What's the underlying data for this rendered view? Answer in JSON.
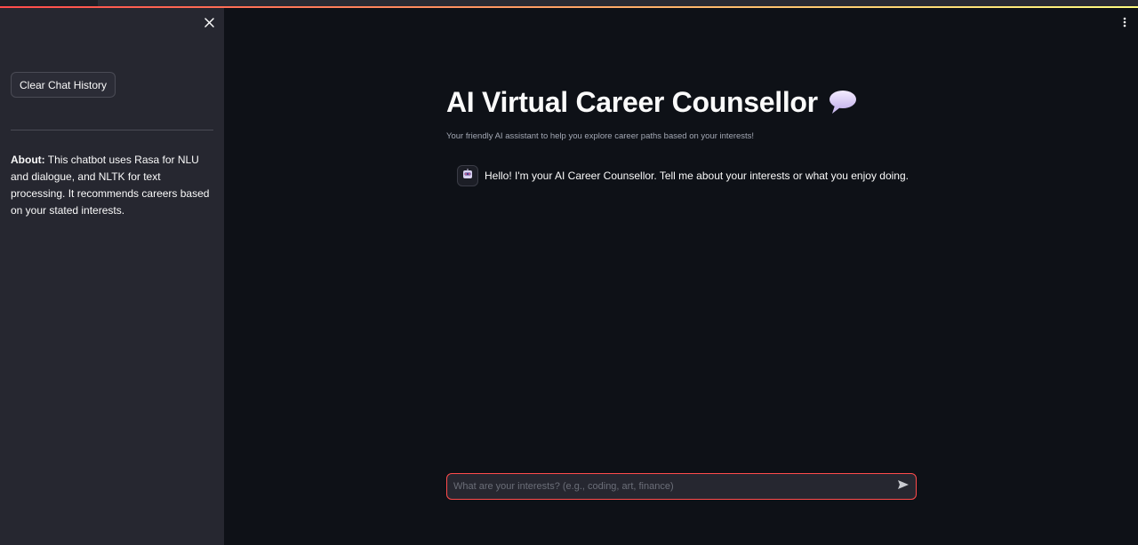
{
  "sidebar": {
    "close_icon": "close-icon",
    "clear_button_label": "Clear Chat History",
    "about_label": "About:",
    "about_text": " This chatbot uses Rasa for NLU and dialogue, and NLTK for text processing. It recommends careers based on your stated interests."
  },
  "header": {
    "menu_icon": "kebab-menu-icon",
    "decoration_colors": [
      "#ff4b4b",
      "#fffd80"
    ]
  },
  "main": {
    "title": "AI Virtual Career Counsellor",
    "title_icon": "speech-balloon-icon",
    "subtitle": "Your friendly AI assistant to help you explore career paths based on your interests!"
  },
  "chat": {
    "messages": [
      {
        "role": "assistant",
        "avatar_icon": "robot-icon",
        "text": "Hello! I'm your AI Career Counsellor. Tell me about your interests or what you enjoy doing."
      }
    ],
    "input": {
      "placeholder": "What are your interests? (e.g., coding, art, finance)",
      "value": "",
      "send_icon": "send-icon"
    }
  },
  "colors": {
    "background": "#0e1117",
    "sidebar": "#262730",
    "accent": "#ff4b4b",
    "text": "#fafafa"
  }
}
